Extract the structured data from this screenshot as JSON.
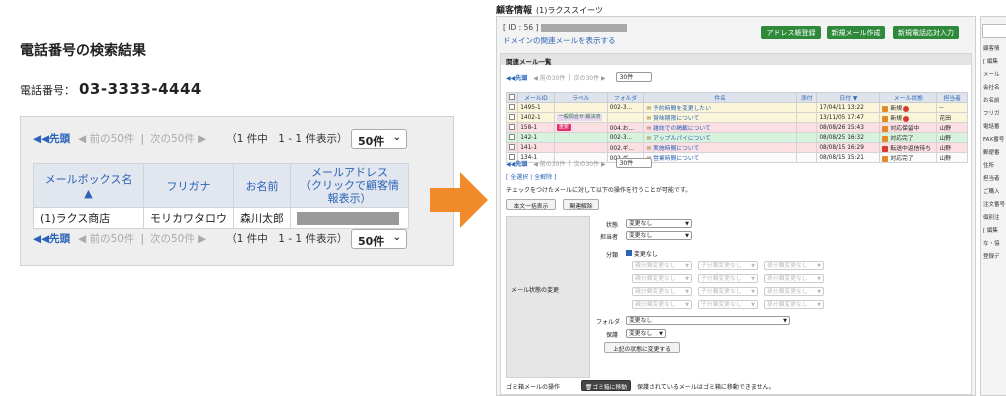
{
  "left": {
    "title": "電話番号の検索結果",
    "phone_label": "電話番号：",
    "phone_number": "03-3333-4444",
    "pager": {
      "first": "◀◀先頭",
      "prev": "◀ 前の50件",
      "next": "次の50件 ▶",
      "count": "（1 件中　1 - 1 件表示）",
      "per_page": "50件"
    },
    "table": {
      "headers": [
        "メールボックス名 ▲",
        "フリガナ",
        "お名前",
        "メールアドレス\n（クリックで顧客情報表示）"
      ],
      "row": {
        "mailbox": "(1)ラクス商店",
        "furigana": "モリカワタロウ",
        "name": "森川太郎"
      }
    }
  },
  "right": {
    "header_title": "顧客情報",
    "header_sub": "(1)ラクススイーツ",
    "id_label": "[ ID : 56 ]",
    "domain_link": "ドメインの関連メールを表示する",
    "buttons": [
      "アドレス帳登録",
      "新規メール作成",
      "新規電話応対入力"
    ],
    "section_title": "関連メール一覧",
    "pager": {
      "first": "◀◀先頭",
      "prev": "◀ 前の30件",
      "next": "次の30件 ▶",
      "per_page": "30件"
    },
    "columns": [
      "",
      "メールID",
      "ラベル",
      "フォルダ",
      "件名",
      "添付",
      "日付 ▼",
      "メール状態",
      "担当者"
    ],
    "rows": [
      {
        "id": "1495-1",
        "label": "",
        "folder": "002-3...",
        "subject": "予約時間を変更したい",
        "attach": "",
        "date": "17/04/11 13:22",
        "status": "新規",
        "assignee": "--",
        "bg": "#fbf6d9",
        "status_color": "#e08a2a",
        "alert": true
      },
      {
        "id": "1402-1",
        "label": "一般問合せ 解決済",
        "folder": "",
        "subject": "賞味期限について",
        "attach": "",
        "date": "13/11/05 17:47",
        "status": "新規",
        "assignee": "花田",
        "bg": "#fbf6d9",
        "status_color": "#e08a2a",
        "alert": true
      },
      {
        "id": "158-1",
        "label": "重要",
        "folder": "004.お...",
        "subject": "雑誌での掲載について",
        "attach": "",
        "date": "08/08/26 15:43",
        "status": "対応保留中",
        "assignee": "山野",
        "bg": "#fbdfe2",
        "status_color": "#e08a2a",
        "alert": false
      },
      {
        "id": "142-1",
        "label": "",
        "folder": "002-3...",
        "subject": "アップルパイについて",
        "attach": "",
        "date": "08/08/25 16:32",
        "status": "対応完了",
        "assignee": "山野",
        "bg": "#d7f3dd",
        "status_color": "#e08a2a",
        "alert": false
      },
      {
        "id": "141-1",
        "label": "",
        "folder": "002.ギ...",
        "subject": "実施時間について",
        "attach": "",
        "date": "08/08/15 16:29",
        "status": "転送中返信待ち",
        "assignee": "山野",
        "bg": "#fbdfe2",
        "status_color": "#d83a2e",
        "alert": false
      },
      {
        "id": "134-1",
        "label": "",
        "folder": "002.ギ...",
        "subject": "営業時間について",
        "attach": "",
        "date": "08/08/15 15:21",
        "status": "対応完了",
        "assignee": "山野",
        "bg": "#fbfbfb",
        "status_color": "#e08a2a",
        "alert": false
      }
    ],
    "bulk_links": "[ 全選択 | 全解除 ]",
    "bulk_note": "チェックをつけたメールに対して以下の操作を行うことが可能です。",
    "btn_show_all": "本文一括表示",
    "btn_relation": "関連解除",
    "form": {
      "section_label": "メール状態の変更",
      "status_label": "状態",
      "assignee_label": "担当者",
      "category_label": "分類",
      "folder_label": "フォルダ",
      "keep_label": "保護",
      "nochange": "変更なし",
      "parent_cat": "親分類変更なし",
      "child_cat": "子分類変更なし",
      "grand_cat": "孫分類変更なし",
      "apply_btn": "上記の状態に変更する"
    },
    "trash_label": "ゴミ箱メールの操作",
    "trash_btn": "ゴミ箱に移動",
    "trash_note": "保護されているメールはゴミ箱に移動できません。"
  },
  "side": {
    "lines": [
      "顧客情",
      "[ 編集",
      "メール",
      "会社名",
      "お名前",
      "フリガ",
      "電話番",
      "FAX番号",
      "郵便番",
      "住所",
      "担当者",
      "ご購入",
      "注文番号",
      "個別注",
      "[ 編集",
      "な・協",
      "登録デ"
    ]
  }
}
